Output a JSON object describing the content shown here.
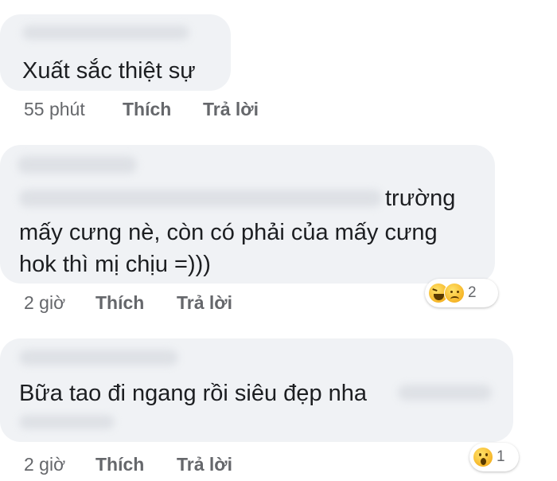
{
  "comments": [
    {
      "text_lines": [
        "Xuất sắc thiệt sự"
      ],
      "time": "55 phút",
      "like_label": "Thích",
      "reply_label": "Trả lời"
    },
    {
      "text_lines": [
        "trường",
        "mấy cưng nè, còn có phải của mấy cưng",
        "hok thì mị chịu =)))"
      ],
      "time": "2 giờ",
      "like_label": "Thích",
      "reply_label": "Trả lời",
      "reactions": {
        "icons": [
          "haha-icon",
          "sad-icon"
        ],
        "count": "2"
      }
    },
    {
      "text_lines": [
        "Bữa tao đi ngang rồi siêu đẹp nha"
      ],
      "time": "2 giờ",
      "like_label": "Thích",
      "reply_label": "Trả lời",
      "reactions": {
        "icons": [
          "wow-icon"
        ],
        "count": "1"
      }
    }
  ]
}
